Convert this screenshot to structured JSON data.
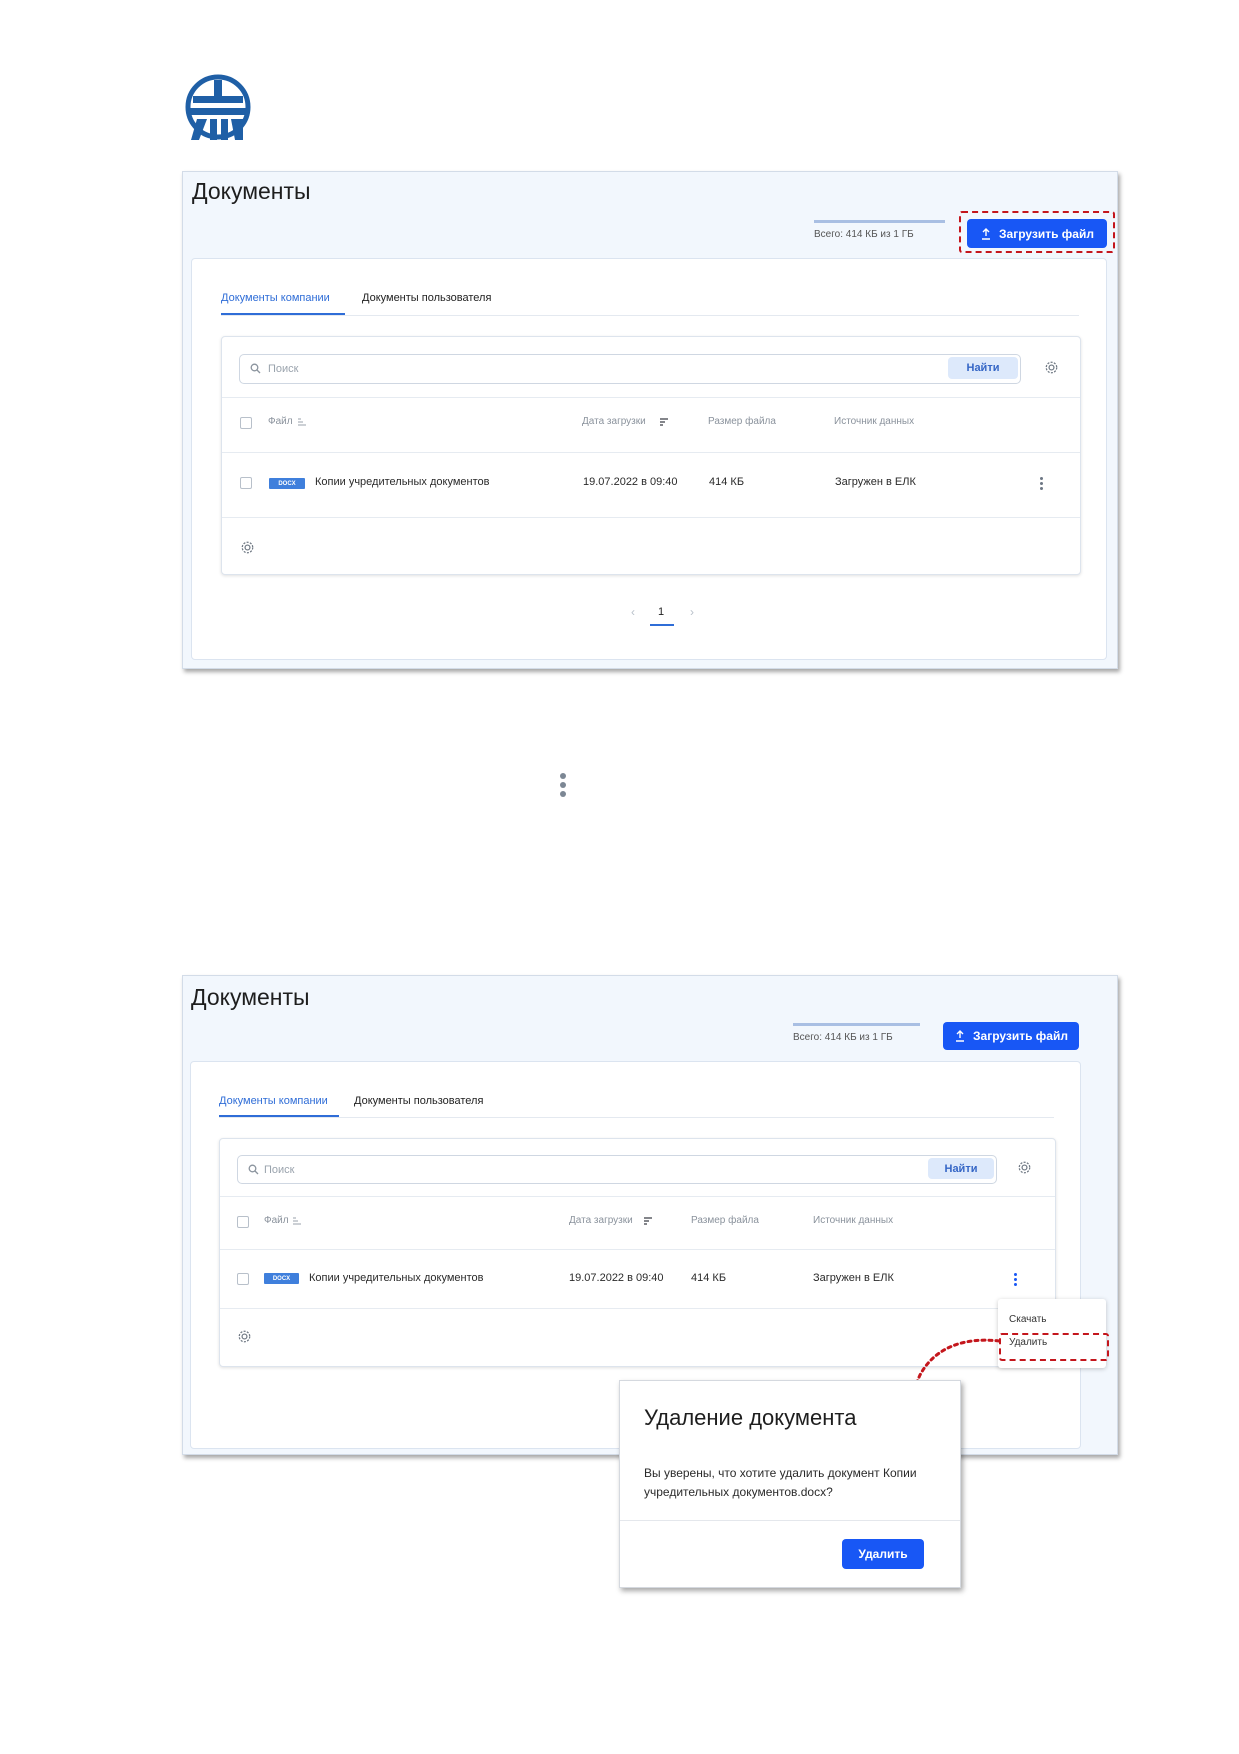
{
  "screen1": {
    "title": "Документы",
    "storage": {
      "text": "Всего: 414 КБ из 1 ГБ",
      "used_fraction": 1.0
    },
    "upload_button": "Загрузить файл",
    "tabs": [
      "Документы компании",
      "Документы пользователя"
    ],
    "search": {
      "placeholder": "Поиск",
      "button": "Найти"
    },
    "columns": {
      "file": "Файл",
      "date": "Дата загрузки",
      "size": "Размер файла",
      "source": "Источник данных"
    },
    "row": {
      "badge": "DOCX",
      "name": "Копии учредительных документов",
      "date": "19.07.2022 в 09:40",
      "size": "414 КБ",
      "source": "Загружен в ЕЛК"
    },
    "pagination": {
      "prev": "‹",
      "current": "1",
      "next": "›"
    }
  },
  "screen2": {
    "title": "Документы",
    "storage": {
      "text": "Всего: 414 КБ из 1 ГБ",
      "used_fraction": 1.0
    },
    "upload_button": "Загрузить файл",
    "tabs": [
      "Документы компании",
      "Документы пользователя"
    ],
    "search": {
      "placeholder": "Поиск",
      "button": "Найти"
    },
    "columns": {
      "file": "Файл",
      "date": "Дата загрузки",
      "size": "Размер файла",
      "source": "Источник данных"
    },
    "row": {
      "badge": "DOCX",
      "name": "Копии учредительных документов",
      "date": "19.07.2022 в 09:40",
      "size": "414 КБ",
      "source": "Загружен в ЕЛК"
    },
    "context_menu": [
      "Скачать",
      "Удалить"
    ]
  },
  "dialog": {
    "title": "Удаление документа",
    "message": "Вы уверены, что хотите удалить документ Копии учредительных документов.docx?",
    "confirm_button": "Удалить"
  },
  "colors": {
    "accent": "#1857f5",
    "link": "#2f6dd7",
    "highlight": "#c4161c",
    "logo": "#1f5fa6"
  }
}
